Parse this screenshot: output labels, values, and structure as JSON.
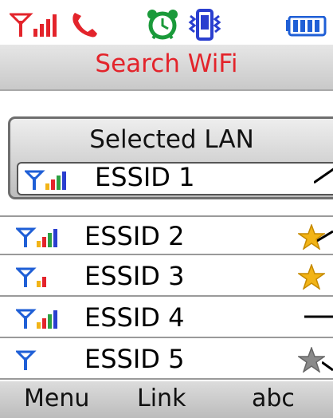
{
  "status_bar": {
    "icons": [
      "signal-icon",
      "call-icon",
      "alarm-clock-icon",
      "vibrate-icon",
      "battery-icon"
    ],
    "colors": {
      "signal": "#e3242b",
      "call": "#e3242b",
      "alarm": "#1a9a3a",
      "vibrate": "#2a3fcf",
      "battery": "#1f5fd6"
    }
  },
  "header": {
    "title": "Search WiFi"
  },
  "panel": {
    "title": "Selected LAN",
    "selected": {
      "ssid": "ESSID 1",
      "signal_bars": 4
    }
  },
  "networks": [
    {
      "ssid": "ESSID 2",
      "signal_bars": 4,
      "favorite": "gold"
    },
    {
      "ssid": "ESSID 3",
      "signal_bars": 2,
      "favorite": "gold"
    },
    {
      "ssid": "ESSID 4",
      "signal_bars": 4,
      "favorite": "none"
    },
    {
      "ssid": "ESSID 5",
      "signal_bars": 0,
      "favorite": "gray"
    }
  ],
  "softkeys": {
    "left": "Menu",
    "center": "Link",
    "right": "abc"
  },
  "colors": {
    "title": "#e3242b",
    "star_gold": "#f2b417",
    "star_gray": "#8a8a8a"
  }
}
